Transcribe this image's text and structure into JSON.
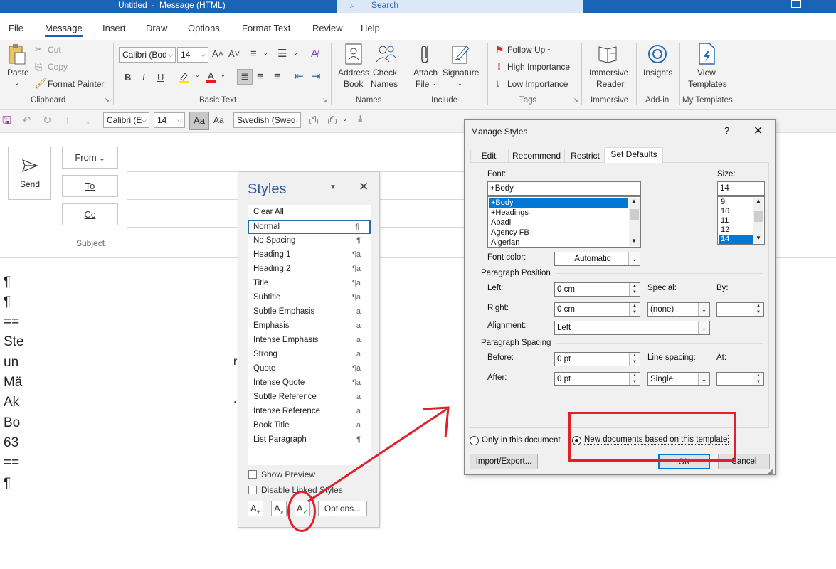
{
  "window": {
    "title": "Untitled  -  Message (HTML)",
    "search_placeholder": "Search"
  },
  "tabs": [
    "File",
    "Message",
    "Insert",
    "Draw",
    "Options",
    "Format Text",
    "Review",
    "Help"
  ],
  "ribbon": {
    "clipboard": {
      "paste": "Paste",
      "cut": "Cut",
      "copy": "Copy",
      "format_painter": "Format Painter",
      "group": "Clipboard"
    },
    "basic_text": {
      "font": "Calibri (Bod",
      "size": "14",
      "group": "Basic Text"
    },
    "names": {
      "address_book_1": "Address",
      "address_book_2": "Book",
      "check_names_1": "Check",
      "check_names_2": "Names",
      "group": "Names"
    },
    "include": {
      "attach_1": "Attach",
      "attach_2": "File",
      "signature": "Signature",
      "group": "Include"
    },
    "tags": {
      "follow_up": "Follow Up",
      "high": "High Importance",
      "low": "Low Importance",
      "group": "Tags"
    },
    "immersive": {
      "reader_1": "Immersive",
      "reader_2": "Reader",
      "group": "Immersive"
    },
    "addin": {
      "insights": "Insights",
      "group": "Add-in"
    },
    "templates": {
      "view_1": "View",
      "view_2": "Templates",
      "group": "My Templates"
    }
  },
  "qat": {
    "font": "Calibri (E",
    "size": "14",
    "lang": "Swedish (Swed"
  },
  "compose": {
    "send": "Send",
    "from": "From",
    "to": "To",
    "cc": "Cc",
    "subject": "Subject",
    "body_lines": [
      "¶",
      "¶",
      "==",
      "Ste",
      "un",
      "Mä",
      "Ak",
      "Bo",
      "63",
      "==",
      "¶"
    ]
  },
  "styles_pane": {
    "title": "Styles",
    "items": [
      {
        "name": "Clear All",
        "sym": ""
      },
      {
        "name": "Normal",
        "sym": "¶"
      },
      {
        "name": "No Spacing",
        "sym": "¶"
      },
      {
        "name": "Heading 1",
        "sym": "¶a"
      },
      {
        "name": "Heading 2",
        "sym": "¶a"
      },
      {
        "name": "Title",
        "sym": "¶a"
      },
      {
        "name": "Subtitle",
        "sym": "¶a"
      },
      {
        "name": "Subtle Emphasis",
        "sym": "a"
      },
      {
        "name": "Emphasis",
        "sym": "a"
      },
      {
        "name": "Intense Emphasis",
        "sym": "a"
      },
      {
        "name": "Strong",
        "sym": "a"
      },
      {
        "name": "Quote",
        "sym": "¶a"
      },
      {
        "name": "Intense Quote",
        "sym": "¶a"
      },
      {
        "name": "Subtle Reference",
        "sym": "a"
      },
      {
        "name": "Intense Reference",
        "sym": "a"
      },
      {
        "name": "Book Title",
        "sym": "a"
      },
      {
        "name": "List Paragraph",
        "sym": "¶"
      }
    ],
    "show_preview": "Show Preview",
    "disable_linked": "Disable Linked Styles",
    "options": "Options..."
  },
  "dialog": {
    "title": "Manage Styles",
    "help": "?",
    "tabs": [
      "Edit",
      "Recommend",
      "Restrict",
      "Set Defaults"
    ],
    "font_label": "Font:",
    "font_value": "+Body",
    "font_list": [
      "+Body",
      "+Headings",
      "Abadi",
      "Agency FB",
      "Algerian"
    ],
    "size_label": "Size:",
    "size_value": "14",
    "size_list": [
      "9",
      "10",
      "11",
      "12",
      "14"
    ],
    "font_color_label": "Font color:",
    "font_color_value": "Automatic",
    "para_position": "Paragraph Position",
    "left_label": "Left:",
    "left_value": "0 cm",
    "right_label": "Right:",
    "right_value": "0 cm",
    "special_label": "Special:",
    "special_value": "(none)",
    "by_label": "By:",
    "alignment_label": "Alignment:",
    "alignment_value": "Left",
    "para_spacing": "Paragraph Spacing",
    "before_label": "Before:",
    "before_value": "0 pt",
    "after_label": "After:",
    "after_value": "0 pt",
    "line_spacing_label": "Line spacing:",
    "line_spacing_value": "Single",
    "at_label": "At:",
    "only_doc": "Only in this document",
    "new_docs": "New documents based on this template",
    "import_export": "Import/Export...",
    "ok": "OK",
    "cancel": "Cancel"
  },
  "colors": {
    "accent": "#1a64b8",
    "annotation": "#e0202a"
  }
}
